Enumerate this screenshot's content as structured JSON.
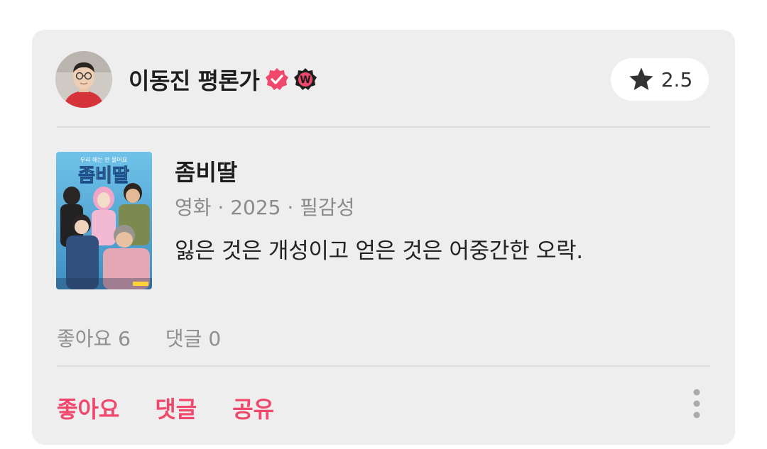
{
  "author": {
    "name": "이동진 평론가",
    "verified_icon": "verified-check-icon",
    "partner_badge": {
      "letter": "W",
      "icon": "w-badge-icon"
    }
  },
  "rating": {
    "icon": "star-icon",
    "value": "2.5"
  },
  "movie": {
    "title": "좀비딸",
    "meta": "영화 · 2025 · 필감성",
    "poster": {
      "tagline": "우리 애는 안 물어요",
      "title": "좀비딸"
    }
  },
  "review": {
    "text": "잃은 것은 개성이고 얻은 것은 어중간한 오락."
  },
  "stats": {
    "likes": "좋아요 6",
    "comments": "댓글 0"
  },
  "actions": {
    "like": "좋아요",
    "comment": "댓글",
    "share": "공유"
  },
  "colors": {
    "accent": "#f0486c",
    "card_bg": "#eeeeee",
    "text": "#1e1e1e",
    "muted": "#8a8a8a"
  }
}
